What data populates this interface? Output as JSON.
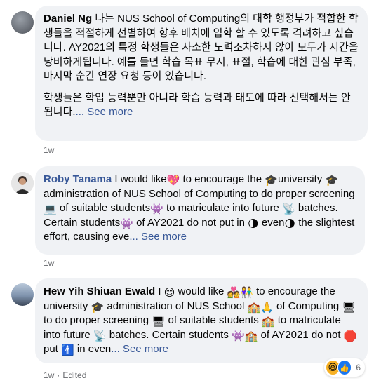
{
  "comments": [
    {
      "author": "Daniel Ng",
      "text_p1": " 나는 NUS School of Computing의 대학 행정부가 적합한 학생들을 적절하게 선별하여 향후 배치에 입학 할 수 있도록 격려하고 싶습니다. AY2021의 특정 학생들은 사소한 노력조차하지 않아 모두가 시간을 낭비하게됩니다. 예를 들면 학습 목표 무시, 표절, 학습에 대한 관심 부족, 마지막 순간 연장 요청 등이 있습니다.",
      "text_p2": "학생들은 학업 능력뿐만 아니라 학습 능력과 태도에 따라 선택해서는 안됩니다.",
      "see_more": "... See more",
      "time": "1w"
    },
    {
      "author": "Roby Tanama",
      "see_more": "... See more",
      "time": "1w",
      "segments": [
        " I would like",
        " to encourage the ",
        "university ",
        " administration of NUS School of Computing to do proper screening",
        " of suitable students",
        " to matriculate into future ",
        " batches. Certain students",
        " of AY2021 do not put in ",
        " even",
        " the slightest effort, causing eve"
      ],
      "emojis": [
        "💖",
        "🎓",
        "🎓",
        "💻",
        "👾",
        "📡",
        "👾",
        "🌗",
        "🌗"
      ]
    },
    {
      "author": "Hew Yih Shiuan Ewald",
      "see_more": "... See more",
      "time": "1w",
      "edited": "Edited",
      "segments": [
        " I ",
        " would like ",
        " to encourage the university ",
        " administration of NUS School ",
        " of Computing ",
        " to do proper screening ",
        " of suitable students ",
        " to matriculate into future ",
        " batches. Certain students ",
        " of AY2021 do not ",
        " put ",
        " in even"
      ],
      "emojis": [
        "😊",
        "💑",
        "👫",
        "🎓",
        "🏫",
        "🙏",
        "🖥",
        "🖥",
        "🏫",
        "📡",
        "👾",
        "🏫",
        "🛑",
        "🚹"
      ]
    }
  ],
  "reactions": {
    "count": "6",
    "icons": [
      "haha-icon",
      "like-icon"
    ],
    "haha": "😆",
    "like": "👍"
  },
  "colors": {
    "bubble": "#f0f2f5",
    "link": "#385898",
    "meta": "#65676b"
  }
}
